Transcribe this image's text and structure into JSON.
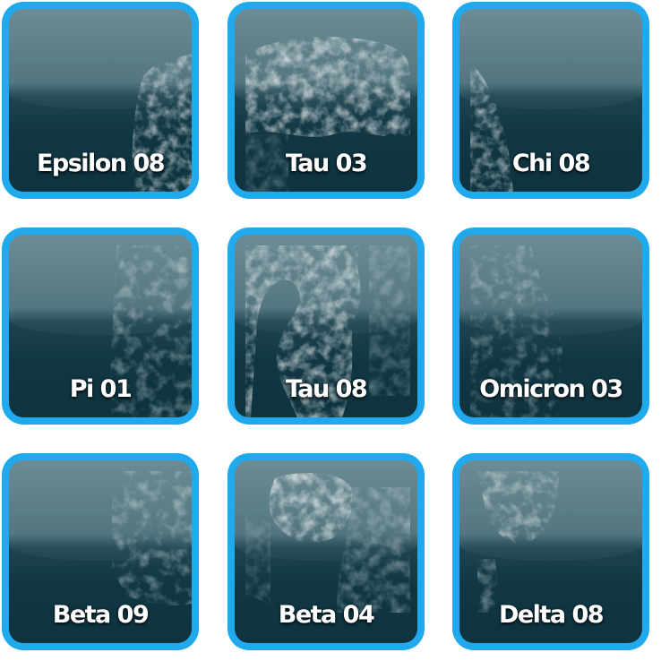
{
  "tiles": [
    {
      "label": "Epsilon 08",
      "image": "textured-white-artwork"
    },
    {
      "label": "Tau 03",
      "image": "textured-white-artwork"
    },
    {
      "label": "Chi 08",
      "image": "textured-white-artwork"
    },
    {
      "label": "Pi 01",
      "image": "textured-white-artwork"
    },
    {
      "label": "Tau 08",
      "image": "textured-white-artwork"
    },
    {
      "label": "Omicron 03",
      "image": "textured-white-artwork"
    },
    {
      "label": "Beta 09",
      "image": "textured-white-artwork"
    },
    {
      "label": "Beta 04",
      "image": "textured-white-artwork"
    },
    {
      "label": "Delta 08",
      "image": "textured-white-artwork"
    }
  ],
  "colors": {
    "tile_border": "#21a9ee",
    "tile_background": "#0f3642",
    "label_text": "#ffffff"
  }
}
